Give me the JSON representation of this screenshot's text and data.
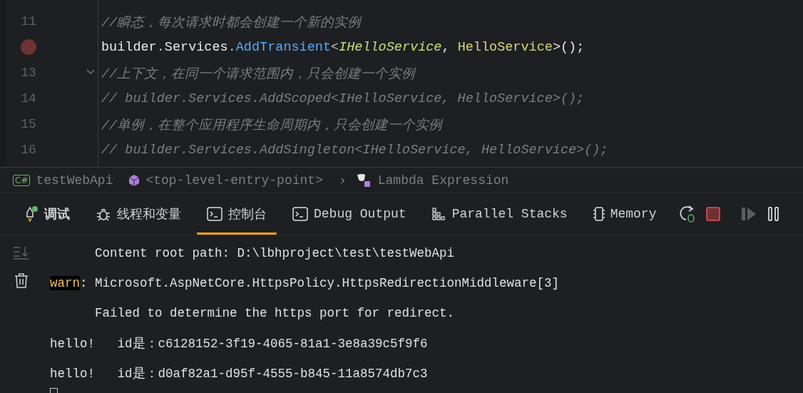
{
  "editor": {
    "lines": [
      {
        "number": "11",
        "breakpoint": false,
        "foldable": false,
        "tokens": [
          {
            "kind": "comment",
            "text": "//瞬态，每次请求时都会创建一个新的实例"
          }
        ]
      },
      {
        "breakpoint": true,
        "foldable": false,
        "tokens": [
          {
            "kind": "plain",
            "text": "builder"
          },
          {
            "kind": "punct",
            "text": "."
          },
          {
            "kind": "plain",
            "text": "Services"
          },
          {
            "kind": "punct",
            "text": "."
          },
          {
            "kind": "method",
            "text": "AddTransient"
          },
          {
            "kind": "punct",
            "text": "<"
          },
          {
            "kind": "interface",
            "text": "IHelloService"
          },
          {
            "kind": "plain",
            "text": ", "
          },
          {
            "kind": "class",
            "text": "HelloService"
          },
          {
            "kind": "plain",
            "text": ">();"
          }
        ]
      },
      {
        "number": "13",
        "breakpoint": false,
        "foldable": true,
        "tokens": [
          {
            "kind": "comment",
            "text": "//上下文，在同一个请求范围内，只会创建一个实例"
          }
        ]
      },
      {
        "number": "14",
        "breakpoint": false,
        "foldable": false,
        "tokens": [
          {
            "kind": "comment",
            "text": "// builder.Services.AddScoped<IHelloService, HelloService>();"
          }
        ]
      },
      {
        "number": "15",
        "breakpoint": false,
        "foldable": false,
        "tokens": [
          {
            "kind": "comment",
            "text": "//单例，在整个应用程序生命周期内，只会创建一个实例"
          }
        ]
      },
      {
        "number": "16",
        "breakpoint": false,
        "foldable": false,
        "tokens": [
          {
            "kind": "comment",
            "text": "// builder.Services.AddSingleton<IHelloService, HelloService>();"
          }
        ]
      }
    ]
  },
  "breadcrumb": [
    {
      "kind": "project",
      "badge": "C#",
      "label": "testWebApi"
    },
    {
      "kind": "member",
      "label": "<top-level-entry-point>"
    },
    {
      "kind": "separator",
      "label": "›"
    },
    {
      "kind": "lambda",
      "label": "Lambda Expression"
    }
  ],
  "tabs": [
    {
      "kind": "debug",
      "label": "调试",
      "selected": false
    },
    {
      "kind": "threads",
      "label": "线程和变量",
      "selected": false
    },
    {
      "kind": "console",
      "label": "控制台",
      "selected": true
    },
    {
      "kind": "output",
      "label": "Debug Output",
      "selected": false
    },
    {
      "kind": "stacks",
      "label": "Parallel Stacks",
      "selected": false
    },
    {
      "kind": "memory",
      "label": "Memory",
      "selected": false
    }
  ],
  "toolbar": [
    {
      "kind": "rerun",
      "disabled": false
    },
    {
      "kind": "stop",
      "disabled": false
    },
    {
      "kind": "resume",
      "disabled": true
    },
    {
      "kind": "pause",
      "disabled": false
    }
  ],
  "console": {
    "lines": [
      {
        "kind": "continuation",
        "text": "Content root path: D:\\lbhproject\\test\\testWebApi"
      },
      {
        "kind": "warn",
        "badge": "warn",
        "text": ": Microsoft.AspNetCore.HttpsPolicy.HttpsRedirectionMiddleware[3]"
      },
      {
        "kind": "continuation",
        "text": "Failed to determine the https port for redirect."
      },
      {
        "kind": "plain",
        "text": "hello!   id是：c6128152-3f19-4065-81a1-3e8a39c5f9f6"
      },
      {
        "kind": "plain",
        "text": "hello!   id是：d0af82a1-d95f-4555-b845-11a8574db7c3"
      }
    ]
  }
}
